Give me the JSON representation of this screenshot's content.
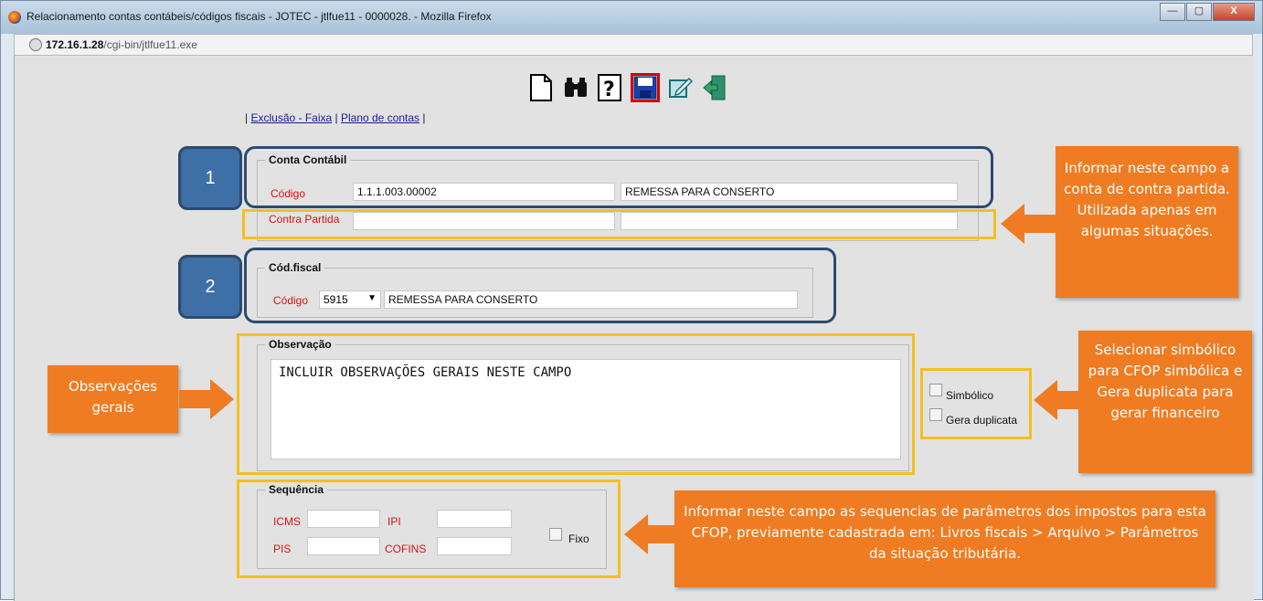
{
  "window": {
    "title": "Relacionamento contas contábeis/códigos fiscais - JOTEC - jtlfue11 - 0000028. - Mozilla Firefox",
    "url_host": "172.16.1.28",
    "url_path": "/cgi-bin/jtlfue11.exe",
    "min": "—",
    "max": "▢",
    "close": "X"
  },
  "toolbar": {
    "new_icon": "new-document-icon",
    "search_icon": "binoculars-icon",
    "help_icon": "help-icon",
    "save_icon": "save-icon",
    "edit_icon": "edit-icon",
    "exit_icon": "exit-icon"
  },
  "links": {
    "sep1": "|",
    "exclusao": "Exclusão - Faixa",
    "sep2": "|",
    "plano": "Plano de contas",
    "sep3": "|"
  },
  "conta_contabil": {
    "legend": "Conta Contábil",
    "codigo_label": "Código",
    "codigo_value": "1.1.1.003.00002",
    "codigo_desc": "REMESSA PARA CONSERTO",
    "contra_label": "Contra Partida",
    "contra_value": "",
    "contra_desc": ""
  },
  "cod_fiscal": {
    "legend": "Cód.fiscal",
    "codigo_label": "Código",
    "codigo_value": "5915",
    "codigo_desc": "REMESSA PARA CONSERTO"
  },
  "observacao": {
    "legend": "Observação",
    "text": "INCLUIR OBSERVAÇÕES GERAIS NESTE CAMPO",
    "simbolico": "Simbólico",
    "gera_duplicata": "Gera duplicata"
  },
  "sequencia": {
    "legend": "Sequência",
    "icms": "ICMS",
    "ipi": "IPI",
    "pis": "PIS",
    "cofins": "COFINS",
    "fixo": "Fixo"
  },
  "badges": {
    "one": "1",
    "two": "2"
  },
  "callouts": {
    "contra": "Informar neste campo a conta de contra partida. Utilizada apenas em algumas situações.",
    "obs": "Observações gerais",
    "simb": "Selecionar simbólico para CFOP simbólica e Gera duplicata para gerar financeiro",
    "seq": "Informar neste campo as sequencias de parâmetros dos impostos para esta CFOP, previamente cadastrada em: Livros fiscais > Arquivo > Parâmetros da situação tributária."
  },
  "colors": {
    "callout": "#ef7c22",
    "highlight_blue": "#2c4a6e",
    "highlight_yellow": "#f4c01e",
    "label_red": "#dd1111"
  }
}
